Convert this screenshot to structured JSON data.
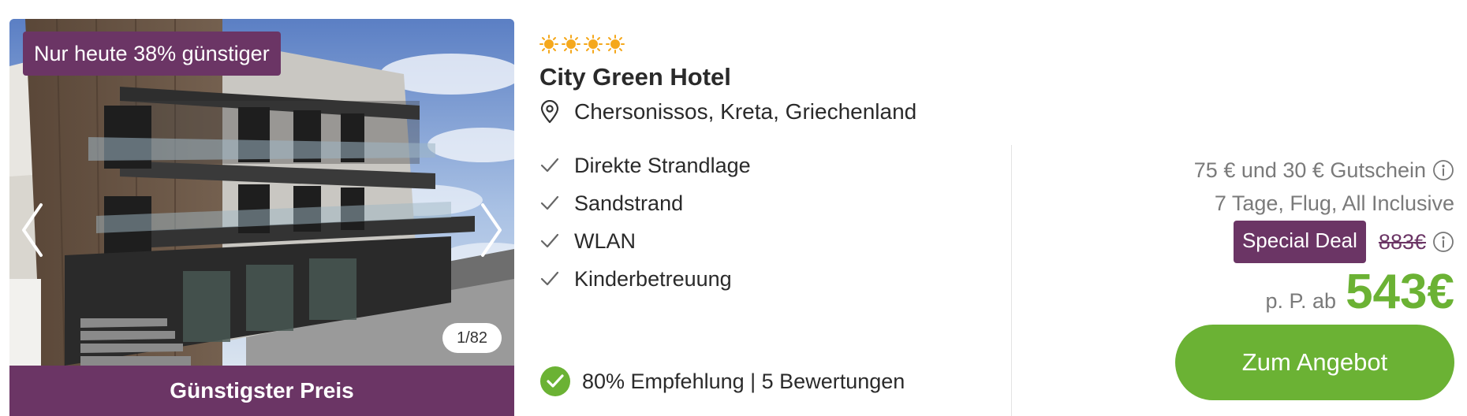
{
  "gallery": {
    "promo_badge": "Nur heute 38% günstiger",
    "counter": "1/82",
    "banner": "Günstigster Preis",
    "prev_icon": "chevron-left-icon",
    "next_icon": "chevron-right-icon"
  },
  "hotel": {
    "stars": 4,
    "star_icon": "sun-icon",
    "star_color": "#f5a81c",
    "name": "City Green Hotel",
    "location_icon": "map-pin-icon",
    "location": "Chersonissos, Kreta, Griechenland",
    "features": [
      {
        "icon": "check-icon",
        "label": "Direkte Strandlage"
      },
      {
        "icon": "check-icon",
        "label": "Sandstrand"
      },
      {
        "icon": "check-icon",
        "label": "WLAN"
      },
      {
        "icon": "check-icon",
        "label": "Kinderbetreuung"
      }
    ],
    "recommendation": {
      "icon": "check-circle-icon",
      "text": "80% Empfehlung | 5 Bewertungen"
    }
  },
  "offer": {
    "voucher": "75 € und 30 € Gutschein",
    "package": "7 Tage, Flug, All Inclusive",
    "deal_badge": "Special Deal",
    "old_price": "883€",
    "price_prefix": "p. P. ab",
    "price": "543€",
    "cta": "Zum Angebot",
    "info_icon": "info-icon"
  },
  "colors": {
    "brand_purple": "#6b3565",
    "accent_green": "#6bb234",
    "muted_text": "#7a7a7a"
  }
}
